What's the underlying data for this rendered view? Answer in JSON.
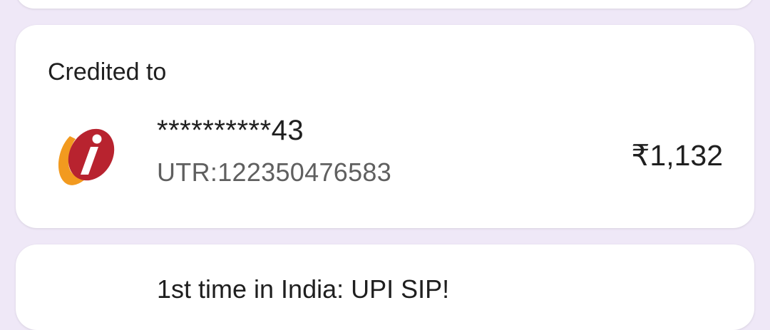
{
  "credited_card": {
    "title": "Credited to",
    "bank_logo": "icici-bank-logo",
    "account_masked": "**********43",
    "utr": "UTR:122350476583",
    "amount": "₹1,132"
  },
  "next_card": {
    "text": "1st time in India: UPI SIP!"
  },
  "colors": {
    "background": "#efe8f7",
    "card": "#ffffff",
    "logo_red": "#b8232f",
    "logo_orange": "#f29a1f"
  }
}
